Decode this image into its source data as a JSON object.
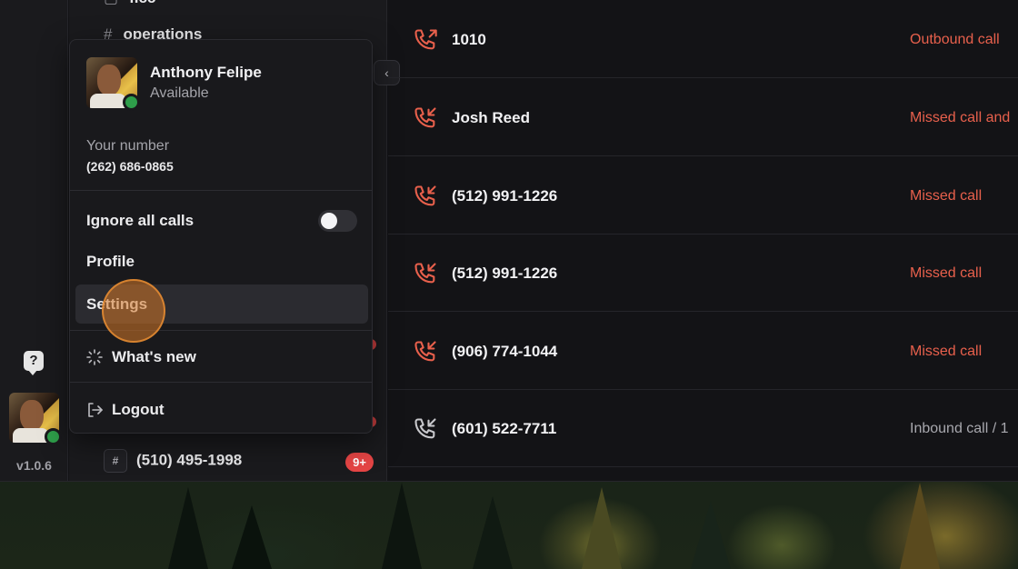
{
  "rail": {
    "version": "v1.0.6",
    "help_icon": "question-bubble-icon"
  },
  "channels": {
    "partial_top": "ficc",
    "operations": "operations",
    "bottom_channel": "(510) 495-1998",
    "bottom_badge": "9+",
    "hash": "#"
  },
  "user_menu": {
    "name": "Anthony Felipe",
    "status": "Available",
    "your_number_label": "Your number",
    "your_number": "(262) 686-0865",
    "ignore_calls_label": "Ignore all calls",
    "ignore_calls_on": false,
    "profile_label": "Profile",
    "settings_label": "Settings",
    "whats_new_label": "What's new",
    "logout_label": "Logout"
  },
  "calls": [
    {
      "name": "1010",
      "status": "Outbound call",
      "direction": "outbound",
      "status_color": "#e8604c"
    },
    {
      "name": "Josh Reed",
      "status": "Missed call and",
      "direction": "missed",
      "status_color": "#e8604c"
    },
    {
      "name": "(512) 991-1226",
      "status": "Missed call",
      "direction": "missed",
      "status_color": "#e8604c"
    },
    {
      "name": "(512) 991-1226",
      "status": "Missed call",
      "direction": "missed",
      "status_color": "#e8604c"
    },
    {
      "name": "(906) 774-1044",
      "status": "Missed call",
      "direction": "missed",
      "status_color": "#e8604c"
    },
    {
      "name": "(601) 522-7711",
      "status": "Inbound call / 1",
      "direction": "inbound",
      "status_color": "#a8a8ae"
    }
  ],
  "colors": {
    "accent_red": "#e8604c",
    "online_green": "#2e9e4a",
    "badge_red": "#e54545"
  }
}
